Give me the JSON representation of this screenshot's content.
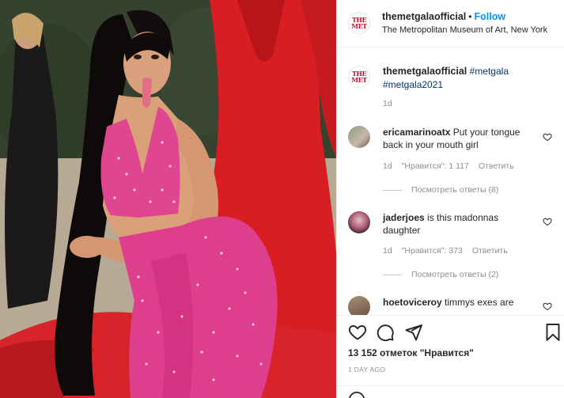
{
  "post": {
    "username": "themetgalaofficial",
    "separator": "•",
    "follow_label": "Follow",
    "location": "The Metropolitan Museum of Art, New York",
    "logo_line1": "THE",
    "logo_line2": "MET",
    "caption": {
      "username": "themetgalaofficial",
      "hashtag1": "#metgala",
      "hashtag2": "#metgala2021",
      "time": "1d"
    }
  },
  "comments": [
    {
      "username": "ericamarinoatx",
      "text": "Put your tongue back in your mouth girl",
      "time": "1d",
      "likes": "\"Нравится\": 1 117",
      "reply_label": "Ответить",
      "view_replies": "Посмотреть ответы (8)"
    },
    {
      "username": "jaderjoes",
      "text": "is this madonnas daughter",
      "time": "1d",
      "likes": "\"Нравится\": 373",
      "reply_label": "Ответить",
      "view_replies": "Посмотреть ответы (2)"
    },
    {
      "username": "hoetoviceroy",
      "text": "timmys exes are"
    }
  ],
  "footer": {
    "likes": "13 152 отметок \"Нравится\"",
    "posted": "1 DAY AGO"
  },
  "icons": {
    "like": "heart-icon",
    "comment": "comment-icon",
    "share": "paper-plane-icon",
    "save": "bookmark-icon"
  },
  "colors": {
    "link_blue": "#0095f6",
    "hashtag": "#00376b",
    "met_red": "#c8102e",
    "dress_pink": "#e0468f",
    "gown_red": "#d81d23"
  }
}
